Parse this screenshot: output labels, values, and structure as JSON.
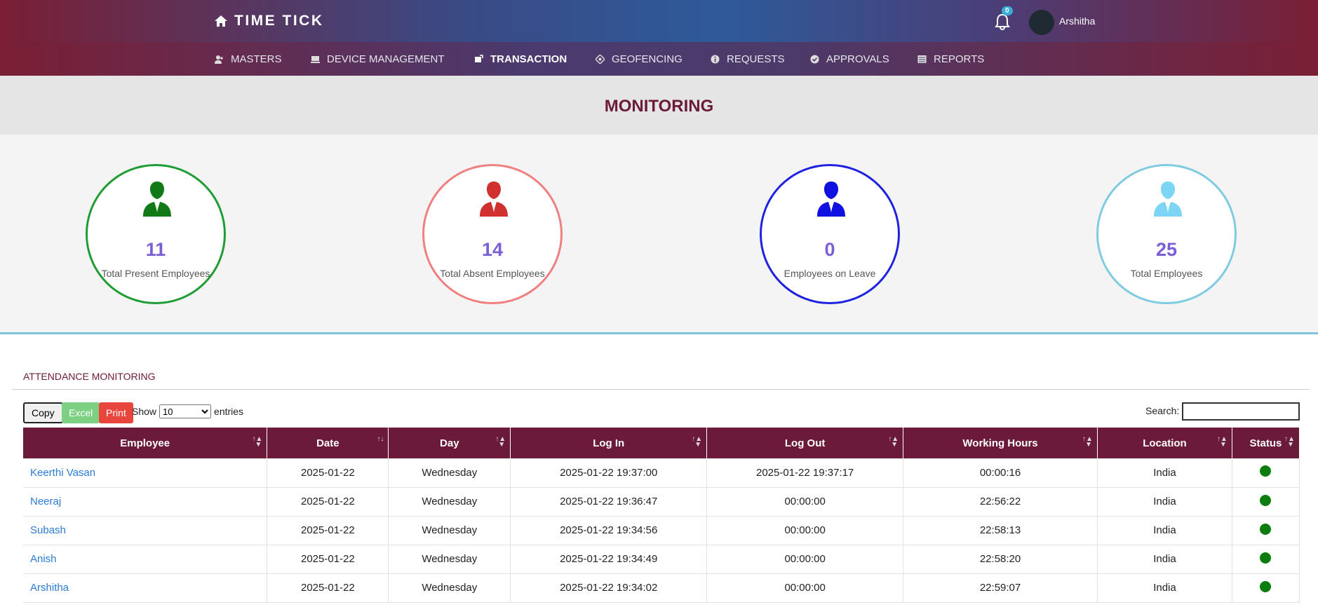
{
  "app": {
    "brand": "TIME TICK",
    "notifications": "0",
    "user": "Arshitha"
  },
  "nav": [
    {
      "label": "MASTERS",
      "icon": "user-add-icon"
    },
    {
      "label": "DEVICE MANAGEMENT",
      "icon": "laptop-icon"
    },
    {
      "label": "TRANSACTION",
      "icon": "exchange-icon"
    },
    {
      "label": "GEOFENCING",
      "icon": "location-icon"
    },
    {
      "label": "REQUESTS",
      "icon": "info-icon"
    },
    {
      "label": "APPROVALS",
      "icon": "check-circle-icon"
    },
    {
      "label": "REPORTS",
      "icon": "report-icon"
    }
  ],
  "page": {
    "title": "MONITORING"
  },
  "stats": [
    {
      "value": "11",
      "label": "Total Present Employees",
      "color": "#1f9d34",
      "icon_color": "#117a17"
    },
    {
      "value": "14",
      "label": "Total Absent Employees",
      "color": "#f08080",
      "icon_color": "#d0312f"
    },
    {
      "value": "0",
      "label": "Employees on Leave",
      "color": "#1e22e0",
      "icon_color": "#1010e0"
    },
    {
      "value": "25",
      "label": "Total Employees",
      "color": "#7fcbe2",
      "icon_color": "#7dd5f5"
    }
  ],
  "table_section": {
    "title": "ATTENDANCE MONITORING",
    "buttons": {
      "copy": "Copy",
      "excel": "Excel",
      "print": "Print"
    },
    "show_label": "Show",
    "show_value": "10",
    "entries_label": "entries",
    "search_label": "Search:",
    "columns": [
      "Employee",
      "Date",
      "Day",
      "Log In",
      "Log Out",
      "Working Hours",
      "Location",
      "Status"
    ],
    "rows": [
      [
        "Keerthi Vasan",
        "2025-01-22",
        "Wednesday",
        "2025-01-22 19:37:00",
        "2025-01-22 19:37:17",
        "00:00:16",
        "India"
      ],
      [
        "Neeraj",
        "2025-01-22",
        "Wednesday",
        "2025-01-22 19:36:47",
        "00:00:00",
        "22:56:22",
        "India"
      ],
      [
        "Subash",
        "2025-01-22",
        "Wednesday",
        "2025-01-22 19:34:56",
        "00:00:00",
        "22:58:13",
        "India"
      ],
      [
        "Anish",
        "2025-01-22",
        "Wednesday",
        "2025-01-22 19:34:49",
        "00:00:00",
        "22:58:20",
        "India"
      ],
      [
        "Arshitha",
        "2025-01-22",
        "Wednesday",
        "2025-01-22 19:34:02",
        "00:00:00",
        "22:59:07",
        "India"
      ]
    ],
    "status_color": "#0d7d10"
  }
}
